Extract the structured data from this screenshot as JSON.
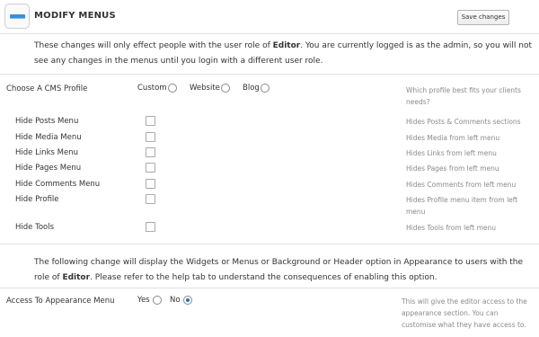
{
  "header": {
    "icon": "menu-icon",
    "title": "MODIFY MENUS",
    "save_label": "Save changes"
  },
  "notice": {
    "text_1": "These changes will only effect people with the user role of ",
    "role": "Editor",
    "text_2": ". You are currently logged is as the admin, so you will not see any changes in the menus until you login with a different user role."
  },
  "profile": {
    "label": "Choose A CMS Profile",
    "options": [
      "Custom",
      "Website",
      "Blog"
    ],
    "help": "Which profile best fits your clients needs?"
  },
  "options": [
    {
      "label": "Hide Posts Menu",
      "help": "Hides Posts & Comments sections"
    },
    {
      "label": "Hide Media Menu",
      "help": "Hides Media from left menu"
    },
    {
      "label": "Hide Links Menu",
      "help": "Hides Links from left menu"
    },
    {
      "label": "Hide Pages Menu",
      "help": "Hides Pages from left menu"
    },
    {
      "label": "Hide Comments Menu",
      "help": "Hides Comments from left menu"
    },
    {
      "label": "Hide Profile",
      "help": "Hides Profile menu item from left menu"
    },
    {
      "label": "Hide Tools",
      "help": "Hides Tools from left menu"
    }
  ],
  "notice2": {
    "text_1": "The following change will display the Widgets or Menus or Background or Header option in Appearance to users with the role of ",
    "role": "Editor",
    "text_2": ". Please refer to the help tab to understand the consequences of enabling this option."
  },
  "appearance": {
    "label": "Access To Appearance Menu",
    "yes_label": "Yes",
    "no_label": "No",
    "selected": "No",
    "help": "This will give the editor access to the appearance section. You can customise what they have access to."
  },
  "colors": {
    "accent": "#2a6fb8",
    "icon_blue": "#3a8fd6",
    "help_text": "#8a8a8a"
  }
}
